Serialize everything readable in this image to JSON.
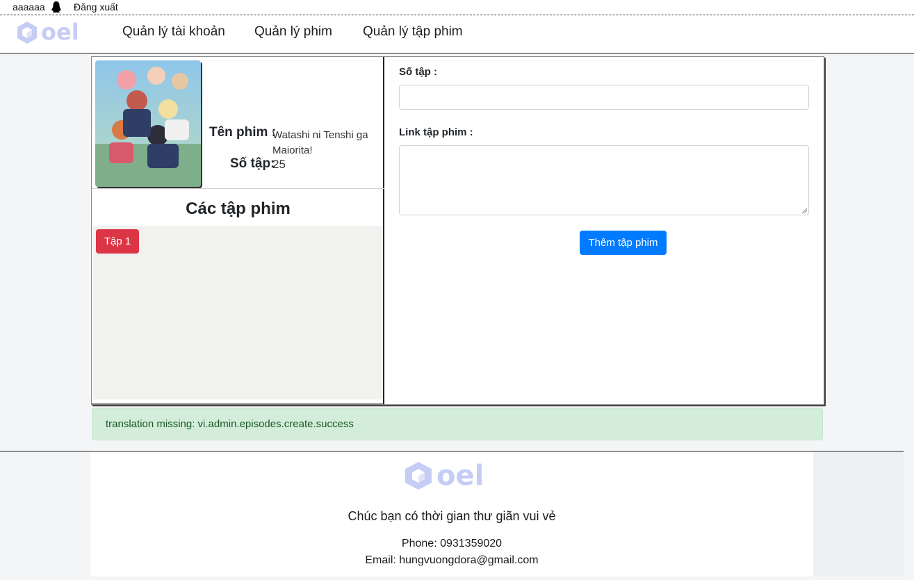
{
  "userbar": {
    "username": "aaaaaa",
    "user_icon": "user-silhouette-icon",
    "logout_label": "Đăng xuất"
  },
  "logo": {
    "text": "oel",
    "icon": "cube-logo-icon",
    "color": "#c5cdf5"
  },
  "nav": {
    "items": [
      {
        "label": "Quản lý tài khoản"
      },
      {
        "label": "Quản lý phim"
      },
      {
        "label": "Quản lý tập phim"
      }
    ]
  },
  "movie": {
    "name_label": "Tên phim :",
    "name_value": "Watashi ni Tenshi ga Maiorita!",
    "episodes_label": "Số tập:",
    "episodes_value": "25"
  },
  "episode_list": {
    "title": "Các tập phim",
    "items": [
      {
        "label": "Tập 1",
        "color": "#dc3545"
      }
    ]
  },
  "form": {
    "episode_number_label": "Số tập :",
    "episode_number_value": "",
    "episode_link_label": "Link tập phim :",
    "episode_link_value": "",
    "submit_label": "Thêm tập phim",
    "submit_color": "#007bff"
  },
  "alert": {
    "message": "translation missing: vi.admin.episodes.create.success",
    "color": "#d4edda"
  },
  "footer": {
    "slogan": "Chúc bạn có thời gian thư giãn vui vẻ",
    "phone": "Phone: 0931359020",
    "email": "Email: hungvuongdora@gmail.com"
  }
}
